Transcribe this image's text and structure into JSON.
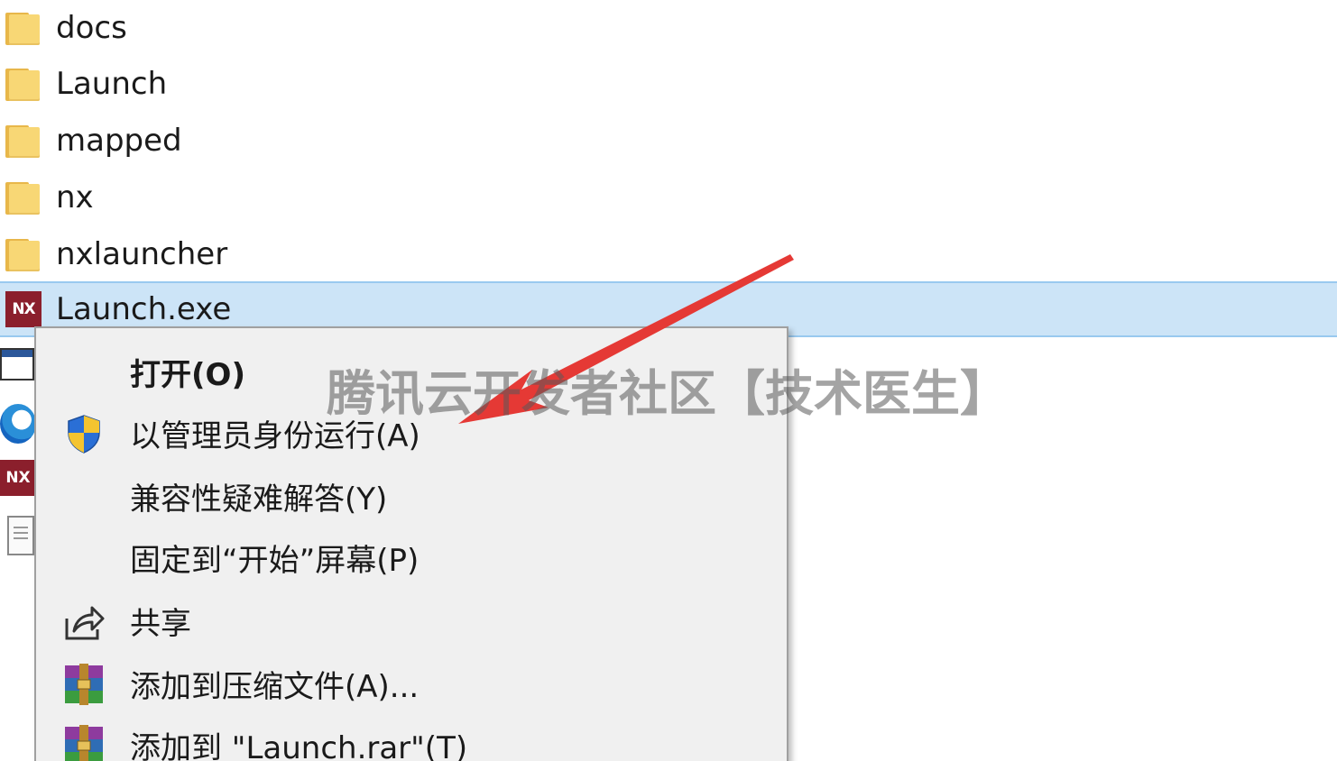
{
  "file_list": {
    "items": [
      {
        "name": "docs",
        "icon": "folder-icon"
      },
      {
        "name": "Launch",
        "icon": "folder-icon"
      },
      {
        "name": "mapped",
        "icon": "folder-icon"
      },
      {
        "name": "nx",
        "icon": "folder-icon"
      },
      {
        "name": "nxlauncher",
        "icon": "folder-icon"
      },
      {
        "name": "Launch.exe",
        "icon": "nx-app-icon",
        "selected": true,
        "icon_text": "NX"
      }
    ],
    "side_icon_text": "NX"
  },
  "context_menu": {
    "items": [
      {
        "label": "打开(O)",
        "icon": "",
        "bold": true
      },
      {
        "label": "以管理员身份运行(A)",
        "icon": "uac-shield-icon"
      },
      {
        "label": "兼容性疑难解答(Y)",
        "icon": ""
      },
      {
        "label": "固定到“开始”屏幕(P)",
        "icon": ""
      },
      {
        "label": "共享",
        "icon": "share-icon"
      },
      {
        "label": "添加到压缩文件(A)...",
        "icon": "winrar-icon"
      },
      {
        "label": "添加到 \"Launch.rar\"(T)",
        "icon": "winrar-icon"
      }
    ]
  },
  "watermark": {
    "text": "腾讯云开发者社区【技术医生】"
  },
  "colors": {
    "selection": "#cce4f7",
    "menu_bg": "#f0f0f0",
    "arrow": "#e53935",
    "folder": "#f8d775",
    "nx_brand": "#8b1f2c"
  }
}
